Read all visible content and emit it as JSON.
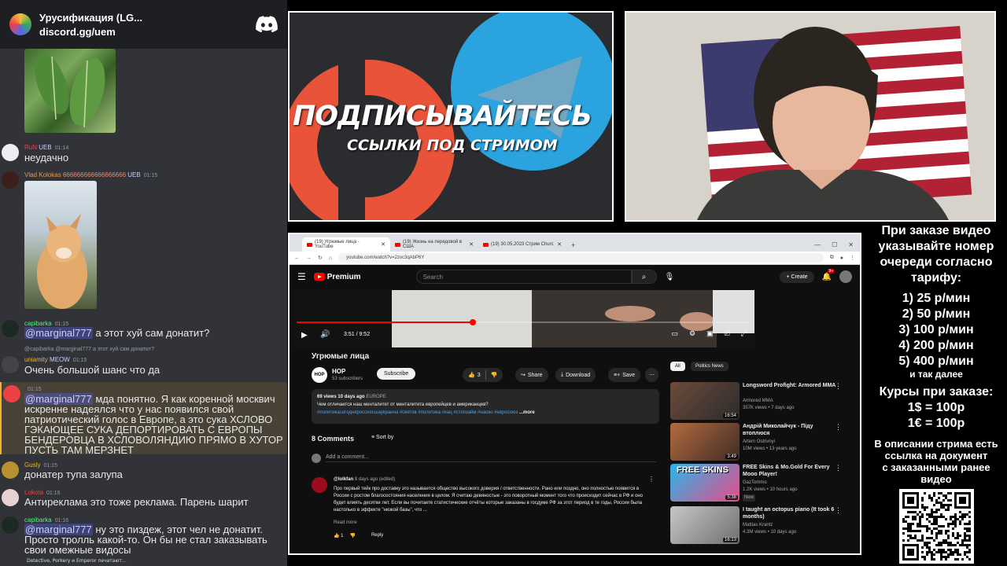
{
  "discord": {
    "server_name": "Урусификация (LG...",
    "invite": "discord.gg/uem",
    "messages": [
      {
        "user": "RuN",
        "badge": "UEB",
        "time": "01:14",
        "text": "неудачно",
        "color": "#ed4245"
      },
      {
        "user": "Vlad Kolokas",
        "tail": "666666666666666666",
        "badge": "UEB",
        "time": "01:15",
        "color": "#e89a4e"
      },
      {
        "user": "capibarka",
        "time": "01:15",
        "mention": "@marginal777",
        "text": "а этот хуй сам донатит?",
        "color": "#57f287"
      },
      {
        "reply": "@capibarka @marginal777 а этот хуй сам донатит?",
        "user": "uniamity",
        "badge": "MEOW",
        "time": "01:15",
        "text": "Очень большой шанс что да",
        "color": "#f0b232"
      },
      {
        "time": "01:15",
        "mention": "@marginal777",
        "text": " мда понятно. Я как коренной москвич искренне надеялся что у нас появился свой патриотический голос в Европе, а это сука ХСЛОВО ГЭКАЮЩЕЕ СУКА ДЕПОРТИРОВАТЬ С ЕВРОПЫ БЕНДЕРОВЦА В ХСЛОВОЛЯНДИЮ ПРЯМО В ХУТОР ПУСТЬ ТАМ МЕРЗНЕТ"
      },
      {
        "user": "Gusly",
        "time": "01:15",
        "text": "донатер тупа залупа",
        "color": "#f0b232"
      },
      {
        "user": "Lokota",
        "time": "01:16",
        "text": "Антиреклама это тоже реклама. Парень шарит",
        "color": "#ed4245"
      },
      {
        "user": "capibarka",
        "time": "01:16",
        "mention": "@marginal777",
        "text": " ну это пиздеж, этот чел не донатит. Просто тролль какой-то. Он бы не стал заказывать свои омежные видосы",
        "color": "#57f287"
      }
    ],
    "typing": "Detective, Porkery и Emperor печатают..."
  },
  "promo": {
    "line1": "ПОДПИСЫВАЙТЕСЬ",
    "line2": "ССЫЛКИ ПОД СТРИМОМ"
  },
  "browser": {
    "tabs": [
      "(19) Угрюмые лица - YouTube",
      "(19) Жизнь на передовой в США",
      "(19) 30.05.2023 Стрим Сhurc"
    ],
    "url": "youtube.com/watch?v=2zvc3qAbP6Y",
    "youtube": {
      "logo": "Premium",
      "search_placeholder": "Search",
      "create": "Create",
      "notif_count": "9+",
      "time": "3:51 / 9:52",
      "progress": 0.39,
      "title": "Угрюмые лица",
      "channel": "HOP",
      "subscribers": "53 subscribers",
      "subscribe": "Subscribe",
      "likes": "3",
      "share": "Share",
      "download": "Download",
      "save": "Save",
      "desc_meta": "69 views  10 days ago",
      "desc_region": "EUROPE",
      "desc_text": "Чем отличается наш менталитет от менталитета европейцев и американцев?",
      "desc_tags": "#политикасегодняроссиясшаукраина #светов #политика #кац #стопзайм #наоко #евросоюз",
      "desc_more": "...more",
      "comments_count": "8 Comments",
      "sort_by": "Sort by",
      "add_comment": "Add a comment...",
      "comment_user": "@lolkfan",
      "comment_time": "8 days ago (edited)",
      "comment_text": "Про первый тейк про доставку это называется общество высокого доверия / ответственности. Рано или поздно, оно полностью появится в России с ростом благосостояния населения в целом. Я считаю девяностые - это поворотный момент того что происходит сейчас в РФ и оно будет влиять десятки лет. Если вы почитаете статистические отчёты которые заказаны в госдуме РФ  за этот период в те годы, России была настолько в эффекте \"низкой базы\", что ...",
      "read_more": "Read more",
      "comment_likes": "1",
      "reply": "Reply",
      "chips": [
        "All",
        "Politics News"
      ],
      "sidebar": [
        {
          "title": "Longsword Profight: Armored MMA",
          "channel": "Armored MMA",
          "meta": "357K views • 7 days ago",
          "dur": "16:54",
          "c1": "#6d4b3b",
          "c2": "#2b2b2b"
        },
        {
          "title": "Андрій Миколайчук - Піду втоплюся",
          "channel": "Artem Ostrivnyi",
          "meta": "10M views • 13 years ago",
          "dur": "3:49",
          "c1": "#b36b3f",
          "c2": "#3f2c25"
        },
        {
          "title": "FREE Skins & Mo.Gold For Every Mooo Player!",
          "channel": "GazTommo",
          "meta": "1.2K views • 10 hours ago",
          "badge": "New",
          "dur": "5:38",
          "c1": "#29b6e8",
          "c2": "#e94a8a"
        },
        {
          "title": "I taught an octopus piano (It took 6 months)",
          "channel": "Mattias Krantz",
          "meta": "4.3M views • 10 days ago",
          "dur": "16:13",
          "c1": "#c7c7c7",
          "c2": "#6f6f6f"
        }
      ]
    }
  },
  "prices": {
    "heading": [
      "При заказе видео",
      "указывайте номер",
      "очереди согласно",
      "тарифу:"
    ],
    "tiers": [
      "1) 25 р/мин",
      "2) 50 р/мин",
      "3) 100 р/мин",
      "4) 200 р/мин",
      "5) 400 р/мин"
    ],
    "etc": "и так далее",
    "rates_heading": "Курсы при заказе:",
    "rates": [
      "1$ = 100р",
      "1€ = 100р"
    ],
    "note": [
      "В описании стрима есть",
      "ссылка на документ",
      "с заказанными ранее",
      "видео"
    ]
  },
  "colors": {
    "discord_bg": "#313338",
    "yt_bg": "#0f0f0f",
    "yt_red": "#ff0000",
    "telegram_blue": "#2aa3df",
    "patreon_orange": "#e8533a"
  }
}
